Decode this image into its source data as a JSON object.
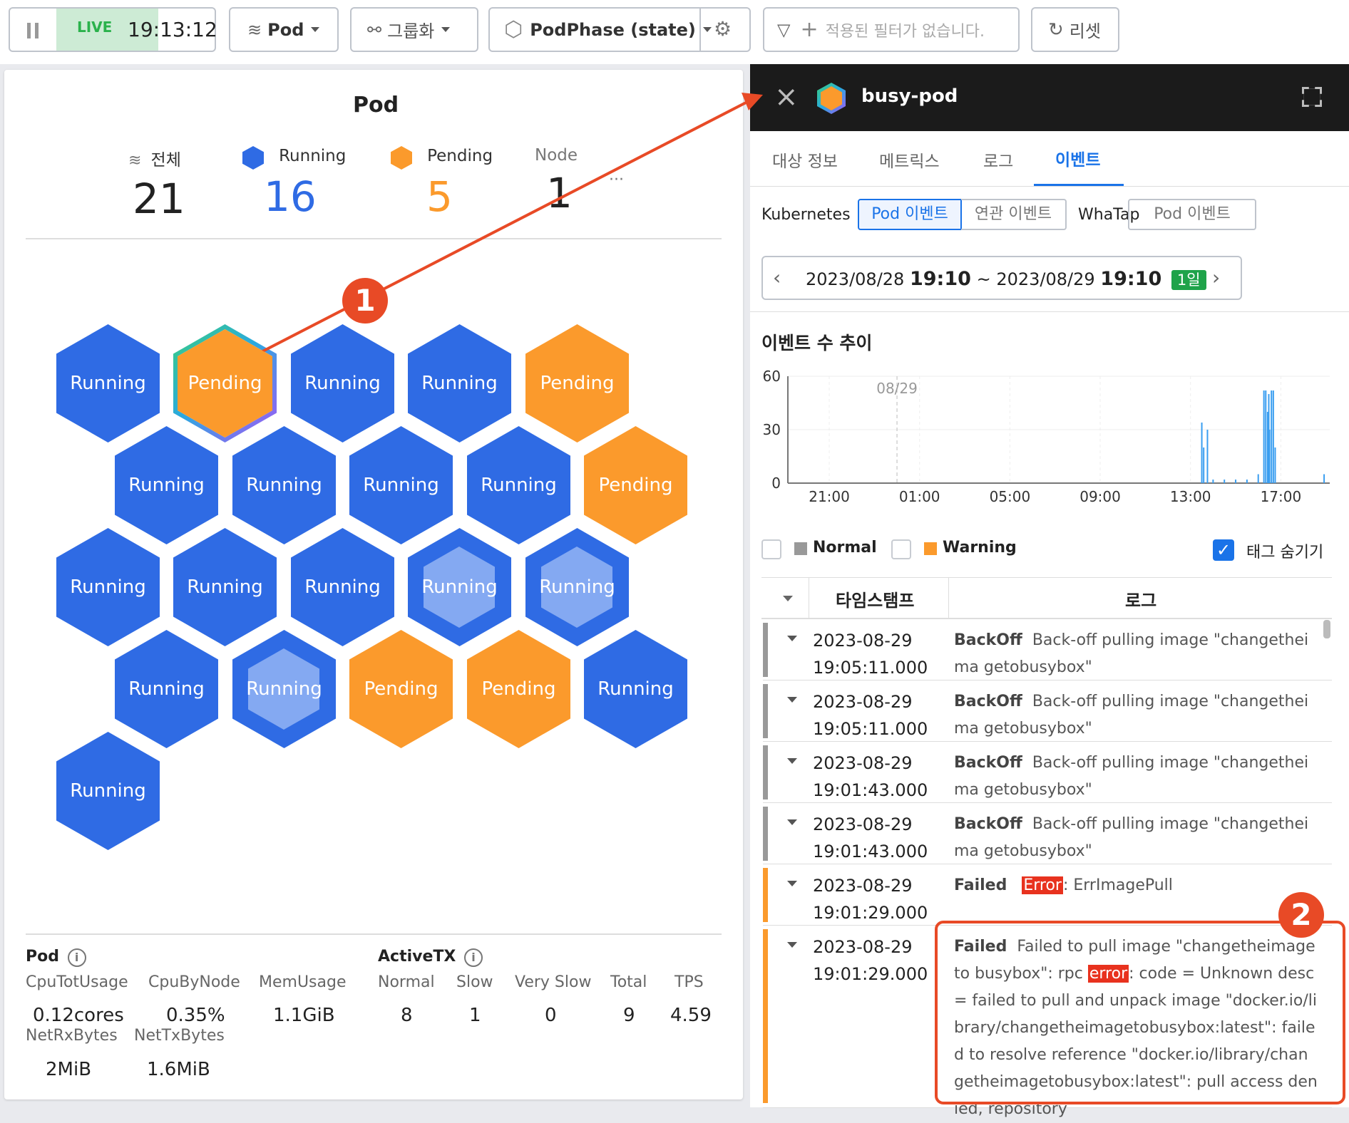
{
  "toolbar": {
    "live_label": "LIVE",
    "time": "19:13:12",
    "pod_select": "Pod",
    "group_button": "그룹화",
    "state_select": "PodPhase (state)",
    "filter_placeholder": "적용된 필터가 없습니다.",
    "reset_button": "리셋"
  },
  "left": {
    "title": "Pod",
    "summary": [
      {
        "label": "전체",
        "value": "21"
      },
      {
        "label": "Running",
        "value": "16"
      },
      {
        "label": "Pending",
        "value": "5"
      },
      {
        "label": "Node",
        "value": "1"
      }
    ],
    "more": "···",
    "hexes": [
      "Running",
      "Pending",
      "Running",
      "Running",
      "Pending",
      "Running",
      "Running",
      "Running",
      "Running",
      "Pending",
      "Running",
      "Running",
      "Running",
      "Running",
      "Running",
      "Running",
      "Running",
      "Pending",
      "Pending",
      "Running",
      "Running"
    ],
    "pod_section": {
      "title": "Pod",
      "labels": [
        "CpuTotUsage",
        "CpuByNode",
        "MemUsage"
      ],
      "values": [
        "0.12cores",
        "0.35%",
        "1.1GiB"
      ],
      "labels2": [
        "NetRxBytes",
        "NetTxBytes"
      ],
      "values2": [
        "2MiB",
        "1.6MiB"
      ]
    },
    "activetx": {
      "title": "ActiveTX",
      "labels": [
        "Normal",
        "Slow",
        "Very Slow",
        "Total",
        "TPS"
      ],
      "values": [
        "8",
        "1",
        "0",
        "9",
        "4.59"
      ]
    },
    "callout_1": "1",
    "callout_2": "2"
  },
  "right": {
    "pod_name": "busy-pod",
    "tabs": [
      "대상 정보",
      "메트릭스",
      "로그",
      "이벤트"
    ],
    "kubernetes_label": "Kubernetes",
    "k8s_seg": [
      "Pod 이벤트",
      "연관 이벤트"
    ],
    "whatap_label": "WhaTap",
    "whatap_seg": "Pod 이벤트",
    "date_from": "2023/08/28",
    "time_from": "19:10",
    "tilde": "~",
    "date_to": "2023/08/29",
    "time_to": "19:10",
    "range_badge": "1일",
    "chart_title": "이벤트 수 추이",
    "legend": {
      "normal": "Normal",
      "warning": "Warning",
      "hide_tags": "태그 숨기기"
    },
    "table_headers": [
      "타임스탬프",
      "로그"
    ],
    "rows": [
      {
        "date": "2023-08-29",
        "time": "19:05:11.000",
        "kind": "BackOff",
        "msg": "Back-off pulling image \"changetheima getobusybox\"",
        "type": "normal"
      },
      {
        "date": "2023-08-29",
        "time": "19:05:11.000",
        "kind": "BackOff",
        "msg": "Back-off pulling image \"changetheima getobusybox\"",
        "type": "normal"
      },
      {
        "date": "2023-08-29",
        "time": "19:01:43.000",
        "kind": "BackOff",
        "msg": "Back-off pulling image \"changetheima getobusybox\"",
        "type": "normal"
      },
      {
        "date": "2023-08-29",
        "time": "19:01:43.000",
        "kind": "BackOff",
        "msg": "Back-off pulling image \"changetheima getobusybox\"",
        "type": "normal"
      },
      {
        "date": "2023-08-29",
        "time": "19:01:29.000",
        "kind": "Failed",
        "hl": "Error",
        "msg": ": ErrImagePull",
        "type": "warning"
      },
      {
        "date": "2023-08-29",
        "time": "19:01:29.000",
        "kind": "Failed",
        "pre": "Failed to pull image \"changetheimageto busybox\": rpc ",
        "hl": "error",
        "msg": ": code = Unknown desc = failed to pull and unpack image \"docker.io/library/changetheimagetobusybox:latest\": failed to resolve reference \"docker.io/library/changetheimagetobusybox:latest\": pull access denied, repository",
        "type": "warning"
      }
    ]
  },
  "chart_data": {
    "type": "bar",
    "title": "이벤트 수 추이",
    "xlabel": "",
    "ylabel": "",
    "ylim": [
      0,
      60
    ],
    "y_ticks": [
      "0",
      "30",
      "60"
    ],
    "x_ticks": [
      "21:00",
      "01:00",
      "05:00",
      "09:00",
      "13:00",
      "17:00"
    ],
    "date_marker": "08/29",
    "x": [
      "13:30",
      "13:35",
      "13:45",
      "14:00",
      "14:30",
      "15:00",
      "15:30",
      "16:00",
      "16:15",
      "16:20",
      "16:25",
      "16:28",
      "16:30",
      "16:35",
      "16:40",
      "16:45",
      "18:55"
    ],
    "values": [
      34,
      20,
      30,
      2,
      2,
      2,
      2,
      5,
      52,
      52,
      40,
      50,
      30,
      52,
      52,
      20,
      5
    ]
  },
  "colors": {
    "running": "#2f6be4",
    "pending": "#fb9a2c",
    "accent": "#1a73e8",
    "callout": "#e84a26"
  }
}
